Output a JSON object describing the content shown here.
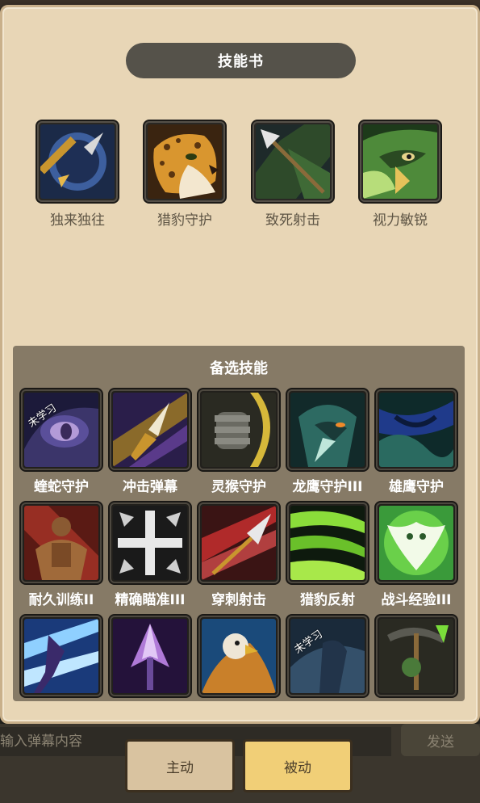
{
  "title": "技能书",
  "equipped": [
    {
      "name": "独来独往",
      "icon": "spear-shield-icon"
    },
    {
      "name": "猎豹守护",
      "icon": "leopard-icon"
    },
    {
      "name": "致死射击",
      "icon": "arrow-icon"
    },
    {
      "name": "视力敏锐",
      "icon": "eagle-eye-icon"
    }
  ],
  "reserve": {
    "title": "备选技能",
    "skills": [
      {
        "name": "蝰蛇守护",
        "icon": "serpent-eye-icon",
        "badge": "未学习"
      },
      {
        "name": "冲击弹幕",
        "icon": "barrage-icon",
        "badge": ""
      },
      {
        "name": "灵猴守护",
        "icon": "monkey-fist-icon",
        "badge": ""
      },
      {
        "name": "龙鹰守护III",
        "icon": "dragonhawk-icon",
        "badge": ""
      },
      {
        "name": "雄鹰守护",
        "icon": "hawk-icon",
        "badge": ""
      },
      {
        "name": "耐久训练II",
        "icon": "muscle-icon",
        "badge": ""
      },
      {
        "name": "精确瞄准III",
        "icon": "crosshair-icon",
        "badge": ""
      },
      {
        "name": "穿刺射击",
        "icon": "piercing-arrow-icon",
        "badge": ""
      },
      {
        "name": "猎豹反射",
        "icon": "green-slash-icon",
        "badge": ""
      },
      {
        "name": "战斗经验III",
        "icon": "owl-icon",
        "badge": ""
      },
      {
        "name": "",
        "icon": "lightning-archer-icon",
        "badge": ""
      },
      {
        "name": "",
        "icon": "purple-arrowhead-icon",
        "badge": ""
      },
      {
        "name": "",
        "icon": "griffin-icon",
        "badge": ""
      },
      {
        "name": "",
        "icon": "shadow-hunter-icon",
        "badge": "未学习"
      },
      {
        "name": "",
        "icon": "pickaxe-icon",
        "badge": ""
      }
    ]
  },
  "danmaku": {
    "placeholder": "输入弹幕内容",
    "send_label": "发送"
  },
  "tabs": [
    {
      "label": "主动",
      "active": false
    },
    {
      "label": "被动",
      "active": true
    }
  ],
  "colors": {
    "panel": "#e8d6b6",
    "reserve": "#867a66",
    "title_bar": "#55524a",
    "active_tab": "#f1cf77"
  }
}
